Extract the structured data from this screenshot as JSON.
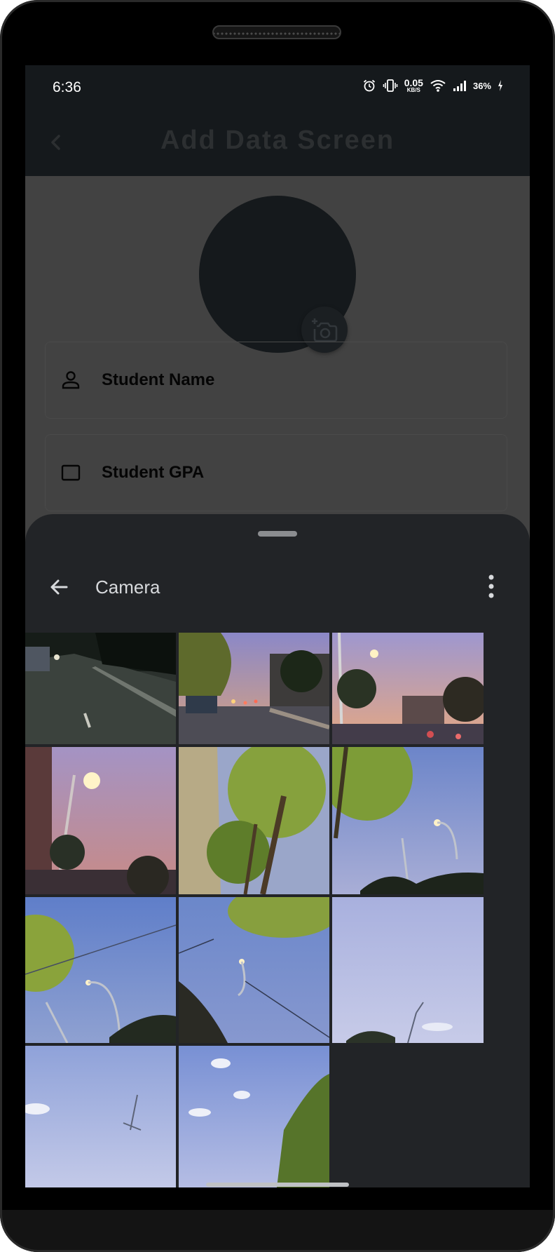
{
  "status_bar": {
    "time": "6:36",
    "net_speed": "0.05",
    "net_unit": "KB/S",
    "battery": "36%"
  },
  "app_bar": {
    "title": "Add Data Screen"
  },
  "form": {
    "student_name_label": "Student Name",
    "field2_label": "Student GPA"
  },
  "sheet": {
    "title": "Camera"
  },
  "icons": {
    "back": "chevron-left-icon",
    "camera": "add-a-photo-icon",
    "person": "person-outline-icon",
    "sheet_back": "arrow-left-icon",
    "more": "more-vert-icon"
  },
  "colors": {
    "app_bar": "#15191c",
    "scrim": "#424242",
    "sheet": "#222427"
  },
  "gallery": {
    "visible_photos": 11
  }
}
